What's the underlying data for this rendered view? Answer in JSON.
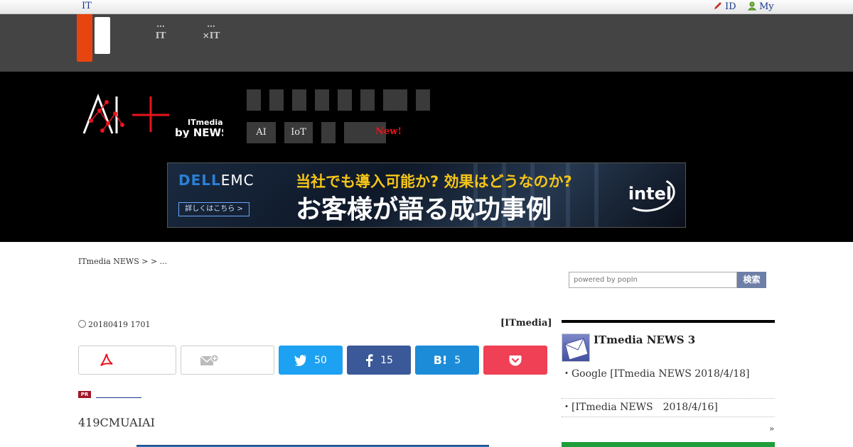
{
  "topbar": {
    "site_label": "IT",
    "id_label": "ID",
    "my_label": "My"
  },
  "graynav": {
    "items": [
      {
        "line1": "…",
        "line2": "IT"
      },
      {
        "line1": "…",
        "line2": "×IT"
      }
    ]
  },
  "header": {
    "logo_text": "AI+",
    "logo_sub_top": "ITmedia",
    "logo_sub_bottom": "by NEWS",
    "menu_pills": [
      "AI",
      "IoT",
      "",
      ""
    ],
    "new_label": "New!"
  },
  "banner": {
    "brand": "DELL",
    "brand2": "EMC",
    "button": "詳しくはこちら >",
    "line1": "当社でも導入可能か? 効果はどうなのか?",
    "line2": "お客様が語る成功事例",
    "partner": "intel"
  },
  "breadcrumb": "ITmedia NEWS >  > ...",
  "search": {
    "placeholder": "powered by popIn",
    "button": "検索"
  },
  "article": {
    "date": "20180419 1701",
    "byline": "[ITmedia]",
    "lead": "419CMUAIAI"
  },
  "share": {
    "twitter": "50",
    "facebook": "15",
    "hatena": "5"
  },
  "sidebar": {
    "title": "ITmedia NEWS 3",
    "items": [
      "Google [ITmedia NEWS 2018/4/18]",
      "[ITmedia NEWS　2018/4/16]"
    ],
    "more": "»"
  },
  "colors": {
    "accent_orange": "#e8440f",
    "twitter": "#1da1f2",
    "facebook": "#3b5998",
    "hatena": "#1d8cd8",
    "pocket": "#ef4056"
  }
}
